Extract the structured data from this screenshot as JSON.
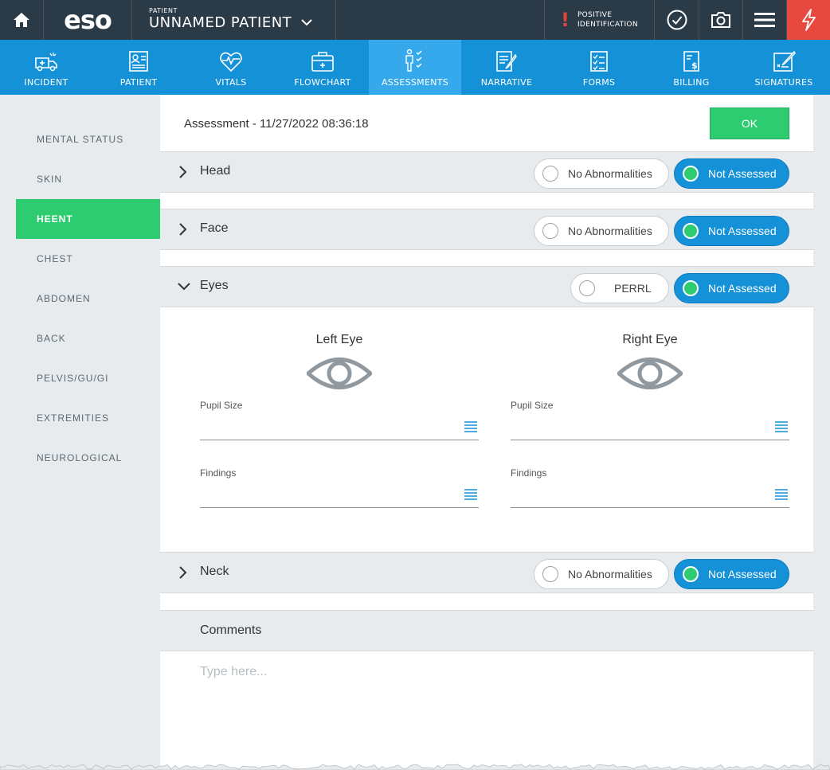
{
  "topbar": {
    "logo": "eso",
    "patient_label": "PATIENT",
    "patient_name": "UNNAMED PATIENT",
    "positive_id_line1": "POSITIVE",
    "positive_id_line2": "IDENTIFICATION",
    "alert_mark": "!",
    "colors": {
      "bar": "#2b3a47",
      "alert": "#e7493f"
    }
  },
  "nav": {
    "items": [
      {
        "label": "INCIDENT",
        "icon": "ambulance-icon"
      },
      {
        "label": "PATIENT",
        "icon": "patient-card-icon"
      },
      {
        "label": "VITALS",
        "icon": "heart-pulse-icon"
      },
      {
        "label": "FLOWCHART",
        "icon": "medical-kit-icon"
      },
      {
        "label": "ASSESSMENTS",
        "icon": "person-checklist-icon",
        "active": true
      },
      {
        "label": "NARRATIVE",
        "icon": "document-pen-icon"
      },
      {
        "label": "FORMS",
        "icon": "checklist-icon"
      },
      {
        "label": "BILLING",
        "icon": "invoice-icon"
      },
      {
        "label": "SIGNATURES",
        "icon": "signature-icon"
      }
    ],
    "colors": {
      "bar": "#1591d8",
      "active": "#36a9ec"
    }
  },
  "sidebar": {
    "items": [
      {
        "label": "MENTAL STATUS"
      },
      {
        "label": "SKIN"
      },
      {
        "label": "HEENT",
        "active": true
      },
      {
        "label": "CHEST"
      },
      {
        "label": "ABDOMEN"
      },
      {
        "label": "BACK"
      },
      {
        "label": "PELVIS/GU/GI"
      },
      {
        "label": "EXTREMITIES"
      },
      {
        "label": "NEUROLOGICAL"
      }
    ],
    "active_color": "#2ecc71"
  },
  "main": {
    "title": "Assessment - 11/27/2022 08:36:18",
    "ok_label": "OK",
    "sections": [
      {
        "title": "Head",
        "left_option": "No Abnormalities",
        "right_option": "Not Assessed",
        "expanded": false
      },
      {
        "title": "Face",
        "left_option": "No Abnormalities",
        "right_option": "Not Assessed",
        "expanded": false
      },
      {
        "title": "Eyes",
        "left_option": "PERRL",
        "right_option": "Not Assessed",
        "expanded": true
      },
      {
        "title": "Neck",
        "left_option": "No Abnormalities",
        "right_option": "Not Assessed",
        "expanded": false
      }
    ],
    "eyes": {
      "left": {
        "title": "Left Eye",
        "pupil_size_label": "Pupil Size",
        "pupil_size_value": "",
        "findings_label": "Findings",
        "findings_value": ""
      },
      "right": {
        "title": "Right Eye",
        "pupil_size_label": "Pupil Size",
        "pupil_size_value": "",
        "findings_label": "Findings",
        "findings_value": ""
      }
    },
    "comments": {
      "label": "Comments",
      "placeholder": "Type here..."
    }
  }
}
